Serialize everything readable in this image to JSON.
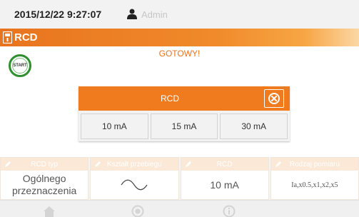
{
  "status_bar": {
    "datetime": "2015/12/22 9:27:07",
    "user": "Admin"
  },
  "title": "RCD",
  "status_message": "GOTOWY!",
  "start_button": {
    "label": "START"
  },
  "dialog": {
    "title": "RCD",
    "options": [
      "10 mA",
      "15 mA",
      "30 mA"
    ]
  },
  "params": [
    {
      "header": "RCD typ",
      "value": "Ogólnego przeznaczenia"
    },
    {
      "header": "Kształt przebiegu",
      "value": ""
    },
    {
      "header": "RCD",
      "value": "10 mA"
    },
    {
      "header": "Rodzaj pomiaru",
      "value": "Ia,x0.5,x1,x2,x5"
    }
  ],
  "colors": {
    "accent": "#f07b1e",
    "start_ring": "#2f8f2f",
    "status_text": "#e8741f"
  },
  "icons": {
    "user": "user-icon",
    "title": "rcd-icon",
    "close": "close-circle-icon",
    "waveform": "sine-wave-icon",
    "toolbar": [
      "home-icon",
      "record-icon",
      "info-icon"
    ]
  }
}
